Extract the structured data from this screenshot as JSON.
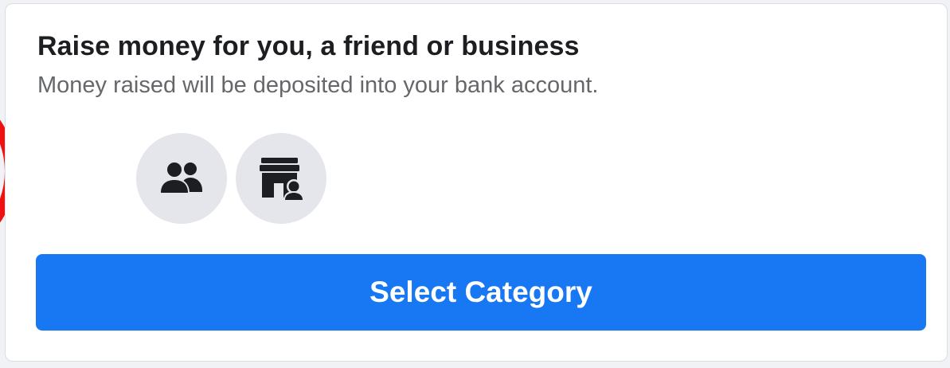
{
  "card": {
    "title": "Raise money for you, a friend or business",
    "subtitle": "Money raised will be deposited into your bank account."
  },
  "options": [
    {
      "icon": "people-icon"
    },
    {
      "icon": "storefront-icon"
    }
  ],
  "button": {
    "label": "Select Category"
  },
  "colors": {
    "accent": "#1877f2",
    "icon_background": "#e4e6eb",
    "title_text": "#1c1e21",
    "subtitle_text": "#65676b",
    "highlight_ring": "#ee1111"
  }
}
